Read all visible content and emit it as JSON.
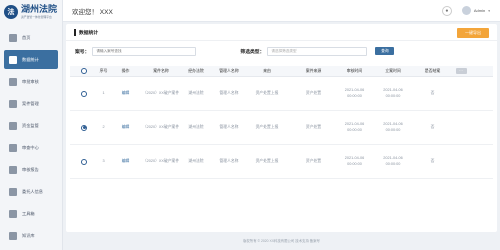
{
  "app": {
    "logo_glyph": "法",
    "logo_title": "湖州法院",
    "logo_sub": "资产监管一体化管理平台"
  },
  "sidebar": {
    "items": [
      {
        "label": "首页",
        "icon": "home-icon",
        "active": false
      },
      {
        "label": "数据统计",
        "icon": "chart-icon",
        "active": true
      },
      {
        "label": "审批审核",
        "icon": "approval-icon",
        "active": false
      },
      {
        "label": "案件管理",
        "icon": "case-icon",
        "active": false
      },
      {
        "label": "资金监管",
        "icon": "money-icon",
        "active": false
      },
      {
        "label": "审查中心",
        "icon": "review-icon",
        "active": false
      },
      {
        "label": "审核报告",
        "icon": "report-icon",
        "active": false
      },
      {
        "label": "委托人信息",
        "icon": "user-icon",
        "active": false
      },
      {
        "label": "工具箱",
        "icon": "toolbox-icon",
        "active": false
      },
      {
        "label": "知识库",
        "icon": "book-icon",
        "active": false
      }
    ]
  },
  "header": {
    "welcome": "欢迎您！ XXX",
    "user": "Admin",
    "caret": "▾"
  },
  "panel": {
    "title": "数据统计",
    "export_label": "一键导出",
    "filter": {
      "case_label": "案号：",
      "case_placeholder": "请输入案号查找",
      "type_label": "筛选类型：",
      "type_placeholder": "请选择筛选类型",
      "query_label": "查询"
    }
  },
  "table": {
    "headers": {
      "no": "序号",
      "op": "操作",
      "name": "案件名称",
      "court": "经办法院",
      "mgr": "管理人名称",
      "src": "来由",
      "type": "案件来源",
      "time1": "审核时间",
      "time2": "立案时间",
      "open": "是否结案"
    },
    "rows": [
      {
        "no": "1",
        "op": "编辑",
        "name": "（2020）XX破产案件",
        "court": "湖州法院",
        "mgr": "管理人名称",
        "src": "资产处置上报",
        "type": "资产处置",
        "time1_date": "2021-04-06",
        "time1_time": "00:00:00",
        "time2_date": "2021-04-06",
        "time2_time": "00:00:00",
        "open": "否",
        "selected": false
      },
      {
        "no": "2",
        "op": "编辑",
        "name": "（2020）XX破产案件",
        "court": "湖州法院",
        "mgr": "管理人名称",
        "src": "资产处置上报",
        "type": "资产处置",
        "time1_date": "2021-04-06",
        "time1_time": "00:00:00",
        "time2_date": "2021-04-06",
        "time2_time": "00:00:00",
        "open": "否",
        "selected": true
      },
      {
        "no": "3",
        "op": "编辑",
        "name": "（2020）XX破产案件",
        "court": "湖州法院",
        "mgr": "管理人名称",
        "src": "资产处置上报",
        "type": "资产处置",
        "time1_date": "2021-04-06",
        "time1_time": "00:00:00",
        "time2_date": "2021-04-06",
        "time2_time": "00:00:00",
        "open": "否",
        "selected": false
      }
    ]
  },
  "footer": {
    "text": "版权所有 © 2020 XX科技有限公司 技术支持 备案号"
  },
  "colors": {
    "primary": "#3b6fa0",
    "accent": "#f3a53a",
    "brand": "#1f4f86"
  }
}
